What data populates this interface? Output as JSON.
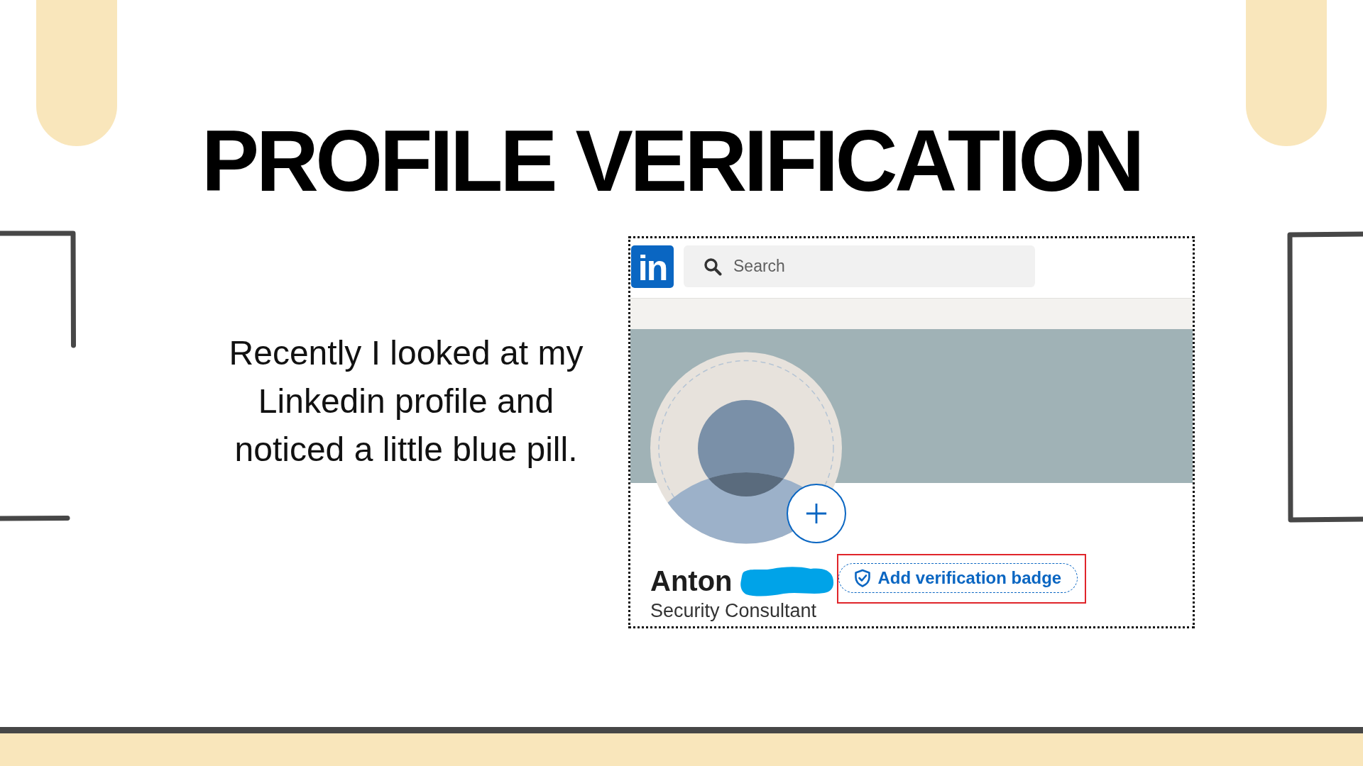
{
  "slide": {
    "title": "PROFILE VERIFICATION",
    "body": "Recently I looked at my Linkedin profile and noticed a little blue pill."
  },
  "screenshot": {
    "logo": "in",
    "search": {
      "placeholder": "Search"
    },
    "profile": {
      "name": "Anton",
      "surname_redacted": true,
      "headline": "Security Consultant"
    },
    "verification_button": {
      "label": "Add verification badge",
      "highlighted": true
    }
  }
}
